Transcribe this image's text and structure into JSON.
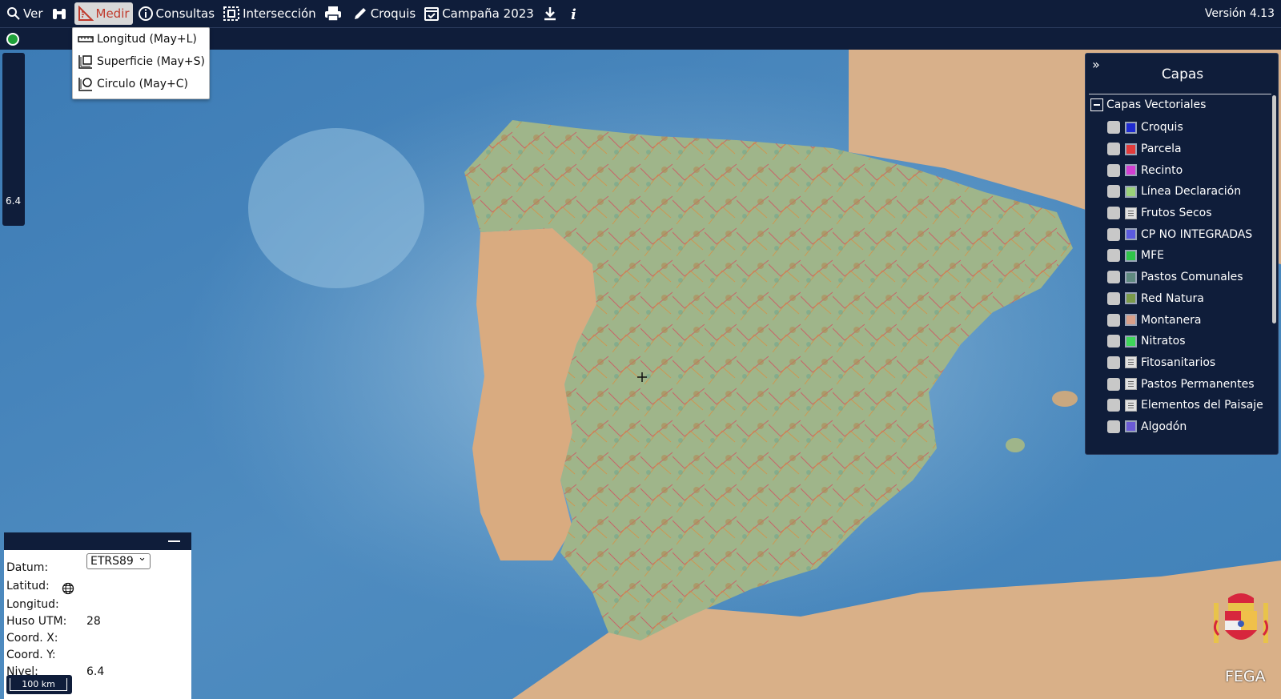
{
  "toolbar": {
    "items": [
      {
        "label": "Ver",
        "icon": "search-icon"
      },
      {
        "label": "",
        "icon": "binoculars-icon"
      },
      {
        "label": "Medir",
        "icon": "ruler-icon",
        "active": true
      },
      {
        "label": "Consultas",
        "icon": "info-icon"
      },
      {
        "label": "Intersección",
        "icon": "intersection-icon"
      },
      {
        "label": "",
        "icon": "print-icon"
      },
      {
        "label": "Croquis",
        "icon": "pencil-icon"
      },
      {
        "label": "Campaña 2023",
        "icon": "calendar-check-icon"
      },
      {
        "label": "",
        "icon": "download-icon"
      },
      {
        "label": "",
        "icon": "italic-info-icon"
      }
    ],
    "version": "Versión 4.13"
  },
  "measure_menu": {
    "items": [
      {
        "label": "Longitud (May+L)",
        "icon": "ruler-line-icon"
      },
      {
        "label": "Superficie (May+S)",
        "icon": "area-icon"
      },
      {
        "label": "Circulo (May+C)",
        "icon": "circle-measure-icon"
      }
    ]
  },
  "zoom": {
    "level": "6.4"
  },
  "layers": {
    "title": "Capas",
    "group": "Capas Vectoriales",
    "items": [
      {
        "label": "Croquis",
        "color": "#1f2bd1"
      },
      {
        "label": "Parcela",
        "color": "#e23b3b"
      },
      {
        "label": "Recinto",
        "color": "#d23fd2"
      },
      {
        "label": "Línea Declaración",
        "color": "#9bd27a"
      },
      {
        "label": "Frutos Secos",
        "color": "list"
      },
      {
        "label": "CP NO INTEGRADAS",
        "color": "#5a5ae0"
      },
      {
        "label": "MFE",
        "color": "#2fc44a"
      },
      {
        "label": "Pastos Comunales",
        "color": "#5f8a80"
      },
      {
        "label": "Red Natura",
        "color": "#7a9a4a"
      },
      {
        "label": "Montanera",
        "color": "#d9a08a"
      },
      {
        "label": "Nitratos",
        "color": "#3ed65a"
      },
      {
        "label": "Fitosanitarios",
        "color": "list"
      },
      {
        "label": "Pastos Permanentes",
        "color": "list"
      },
      {
        "label": "Elementos del Paisaje",
        "color": "list"
      },
      {
        "label": "Algodón",
        "color": "#6b5bd6"
      }
    ]
  },
  "coords": {
    "datum_label": "Datum:",
    "datum_value": "ETRS89",
    "lat_label": "Latitud:",
    "lon_label": "Longitud:",
    "huso_label": "Huso UTM:",
    "huso_value": "28",
    "x_label": "Coord. X:",
    "y_label": "Coord. Y:",
    "nivel_label": "Nivel:",
    "nivel_value": "6.4",
    "scale": "100 km"
  },
  "branding": {
    "name": "FEGA"
  }
}
